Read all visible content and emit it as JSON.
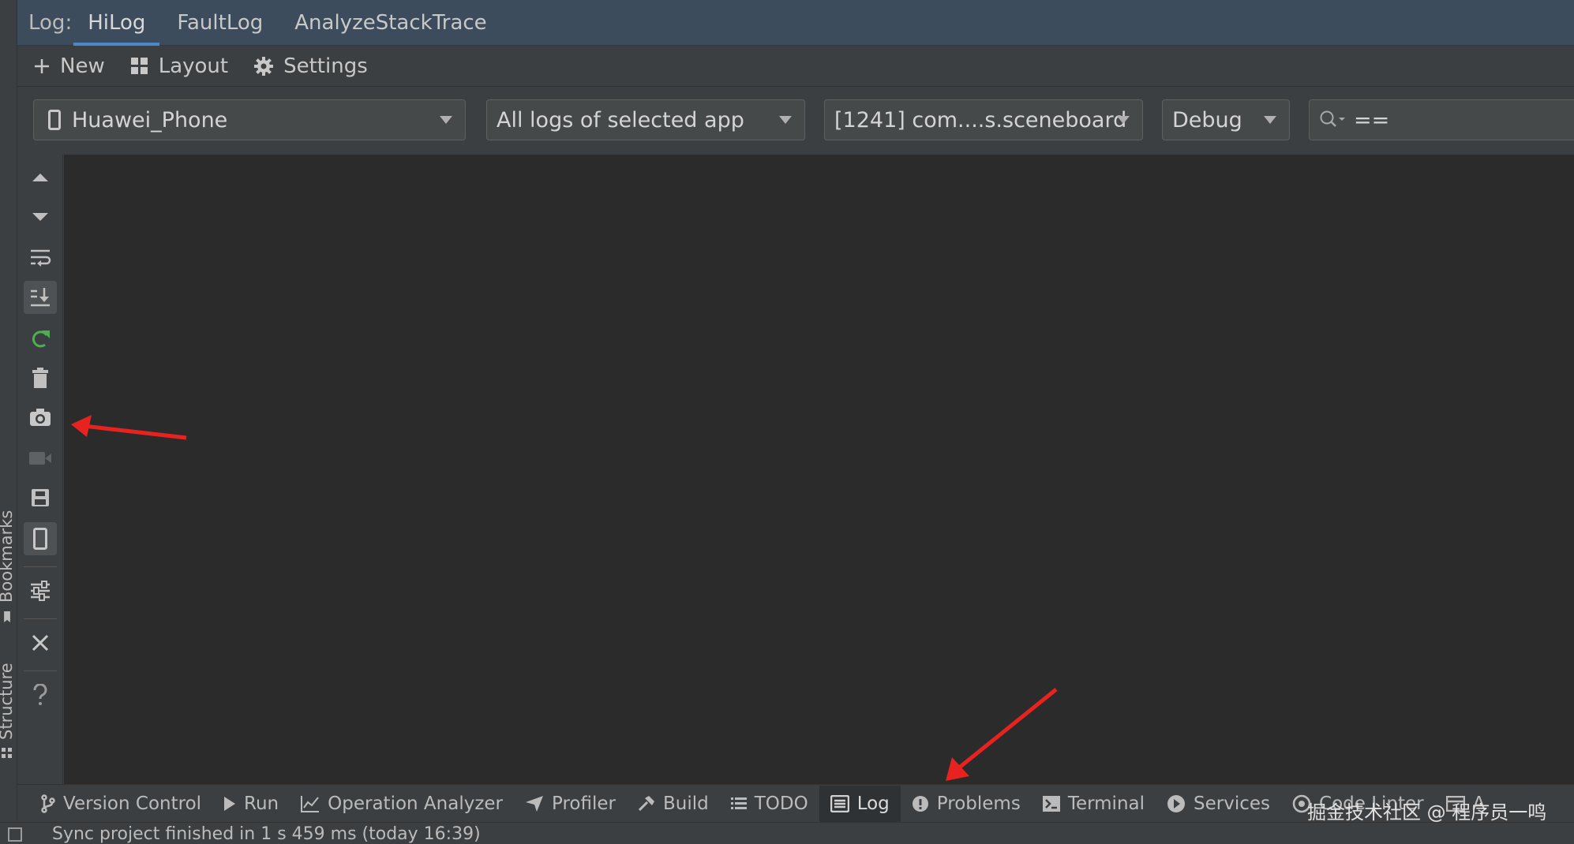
{
  "log_header": {
    "label": "Log:",
    "tabs": [
      {
        "label": "HiLog",
        "active": true
      },
      {
        "label": "FaultLog",
        "active": false
      },
      {
        "label": "AnalyzeStackTrace",
        "active": false
      }
    ]
  },
  "toolbar": {
    "new_label": "New",
    "layout_label": "Layout",
    "settings_label": "Settings"
  },
  "filters": {
    "device": "Huawei_Phone",
    "log_scope": "All logs of selected app",
    "process": "[1241] com....s.sceneboard",
    "level": "Debug",
    "search_value": "=="
  },
  "side_tools": [
    "scroll-up-icon",
    "scroll-down-icon",
    "soft-wrap-icon",
    "scroll-to-end-icon",
    "restart-icon",
    "clear-log-icon",
    "screenshot-icon",
    "screen-record-icon",
    "save-icon",
    "device-icon",
    "filter-settings-icon",
    "close-icon",
    "help-icon"
  ],
  "edge_strip": {
    "bookmarks_label": "Bookmarks",
    "structure_label": "Structure"
  },
  "bottom_bar": {
    "items": [
      {
        "label": "Version Control",
        "icon": "branch-icon"
      },
      {
        "label": "Run",
        "icon": "play-icon"
      },
      {
        "label": "Operation Analyzer",
        "icon": "chart-icon"
      },
      {
        "label": "Profiler",
        "icon": "profiler-icon"
      },
      {
        "label": "Build",
        "icon": "hammer-icon"
      },
      {
        "label": "TODO",
        "icon": "list-icon"
      },
      {
        "label": "Log",
        "icon": "log-icon",
        "active": true
      },
      {
        "label": "Problems",
        "icon": "info-icon"
      },
      {
        "label": "Terminal",
        "icon": "terminal-icon"
      },
      {
        "label": "Services",
        "icon": "services-icon"
      },
      {
        "label": "Code Linter",
        "icon": "linter-icon"
      },
      {
        "label": "A",
        "icon": "more-icon"
      }
    ]
  },
  "status_bar": {
    "message": "Sync project finished in 1 s 459 ms (today 16:39)"
  },
  "watermark": "掘金技术社区 @ 程序员一鸣",
  "colors": {
    "accent": "#4a88c7",
    "annotation_arrow": "#e8231f",
    "restart_green": "#4caf50"
  }
}
